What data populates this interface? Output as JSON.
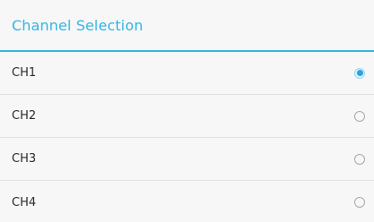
{
  "dialog": {
    "title": "Channel Selection",
    "accent_color": "#33b5e5",
    "options": [
      {
        "label": "CH1",
        "selected": true
      },
      {
        "label": "CH2",
        "selected": false
      },
      {
        "label": "CH3",
        "selected": false
      },
      {
        "label": "CH4",
        "selected": false
      }
    ]
  }
}
